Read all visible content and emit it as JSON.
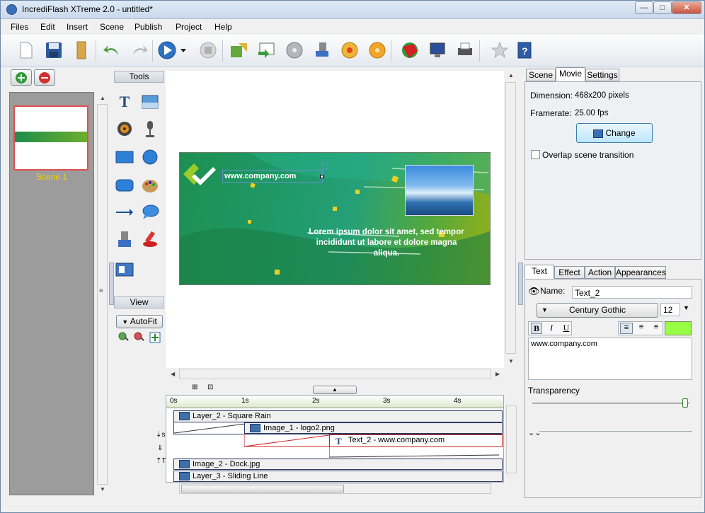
{
  "window": {
    "title": "IncrediFlash XTreme 2.0 - untitled*",
    "min": "—",
    "max": "□",
    "close": "✕"
  },
  "menu": [
    "Files",
    "Edit",
    "Insert",
    "Scene",
    "Publish",
    "Project",
    "Help"
  ],
  "toolbar": [
    "new-file",
    "save",
    "open-folder",
    "undo",
    "redo",
    "play",
    "stop",
    "import",
    "export",
    "cd",
    "wizard",
    "disc",
    "publish-dvd",
    "flash-globe",
    "monitor",
    "print",
    "favorite",
    "help"
  ],
  "scenes": [
    {
      "label": "Scene 1"
    }
  ],
  "tools": {
    "header": "Tools",
    "view_header": "View",
    "autofit": "AutoFit"
  },
  "banner": {
    "url_text": "www.company.com",
    "body_text": "Lorem ipsum dolor sit amet, sed tempor incididunt ut labore et dolore magna aliqua."
  },
  "timeline": {
    "ticks": [
      "0s",
      "1s",
      "2s",
      "3s",
      "4s"
    ],
    "rows": [
      {
        "label": "Layer_2 - Square Rain"
      },
      {
        "label": "Image_1 - logo2.png"
      },
      {
        "label": "Text_2 - www.company.com"
      },
      {
        "label": "Image_2 - Dock.jpg"
      },
      {
        "label": "Layer_3 - Sliding Line"
      }
    ],
    "side_s": "s",
    "side_t": "T"
  },
  "props_top": {
    "tabs": [
      "Scene",
      "Movie",
      "Settings"
    ],
    "active_tab": "Movie",
    "dimension_label": "Dimension:",
    "dimension_value": "468x200 pixels",
    "framerate_label": "Framerate:",
    "framerate_value": "25.00 fps",
    "change_button": "Change",
    "overlap_label": "Overlap scene transition"
  },
  "props_bottom": {
    "tabs": [
      "Text",
      "Effect",
      "Action",
      "Appearances"
    ],
    "active_tab": "Text",
    "name_label": "Name:",
    "name_value": "Text_2",
    "font": "Century Gothic",
    "size": "12",
    "bold": "B",
    "italic": "I",
    "underline": "U",
    "text_content": "www.company.com",
    "transparency_label": "Transparency",
    "text_color": "#99ff44"
  }
}
